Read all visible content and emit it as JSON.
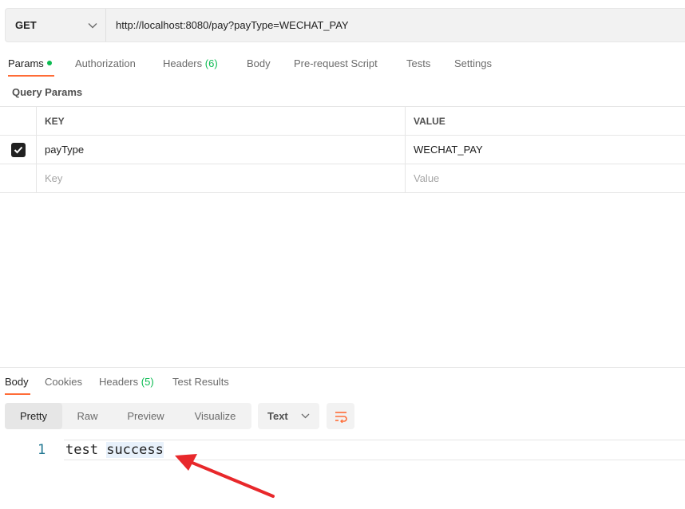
{
  "request": {
    "method": "GET",
    "url": "http://localhost:8080/pay?payType=WECHAT_PAY"
  },
  "request_tabs": [
    {
      "label": "Params",
      "active": true,
      "dot": true
    },
    {
      "label": "Authorization"
    },
    {
      "label": "Headers",
      "count": "(6)"
    },
    {
      "label": "Body"
    },
    {
      "label": "Pre-request Script"
    },
    {
      "label": "Tests"
    },
    {
      "label": "Settings"
    }
  ],
  "query_params": {
    "title": "Query Params",
    "columns": {
      "key": "KEY",
      "value": "VALUE"
    },
    "rows": [
      {
        "checked": true,
        "key": "payType",
        "value": "WECHAT_PAY"
      }
    ],
    "placeholder": {
      "key": "Key",
      "value": "Value"
    }
  },
  "response_tabs": [
    {
      "label": "Body",
      "active": true
    },
    {
      "label": "Cookies"
    },
    {
      "label": "Headers",
      "count": "(5)"
    },
    {
      "label": "Test Results"
    }
  ],
  "response_view": {
    "modes": [
      "Pretty",
      "Raw",
      "Preview",
      "Visualize"
    ],
    "active_mode": "Pretty",
    "format": "Text"
  },
  "response_body": {
    "line_number": "1",
    "word1": "test",
    "word2": "success"
  },
  "colors": {
    "accent": "#ff6c37",
    "count_green": "#0cbb52",
    "annotation_arrow": "#e8282b"
  },
  "icons": [
    "chevron-down-icon",
    "check-icon",
    "wrap-lines-icon",
    "arrow-annotation"
  ]
}
